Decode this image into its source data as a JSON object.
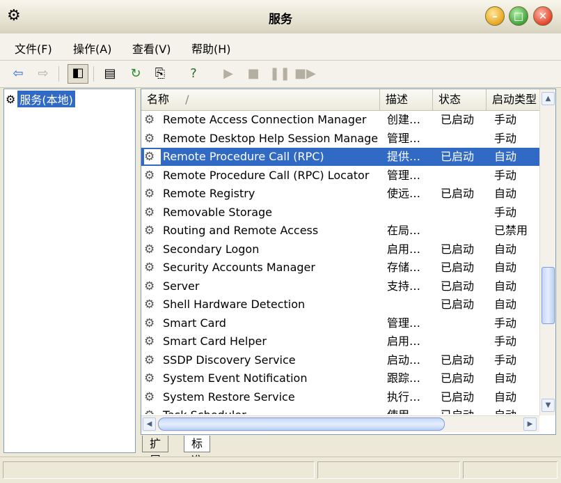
{
  "window": {
    "title": "服务",
    "app_icon": "gears-icon",
    "controls": [
      "minimize",
      "maximize",
      "close"
    ]
  },
  "menu": [
    {
      "label": "文件(F)"
    },
    {
      "label": "操作(A)"
    },
    {
      "label": "查看(V)"
    },
    {
      "label": "帮助(H)"
    }
  ],
  "toolbar": [
    "back",
    "forward",
    "show-hide-console-tree",
    "properties",
    "refresh",
    "export-list",
    "help",
    "start-service",
    "stop-service",
    "pause-service",
    "restart-service"
  ],
  "tree": {
    "root_label": "服务(本地)"
  },
  "list": {
    "columns": [
      "名称",
      "描述",
      "状态",
      "启动类型"
    ],
    "sort_indicator": "/",
    "selected_index": 2,
    "rows": [
      {
        "name": "Remote Access Connection Manager",
        "desc": "创建…",
        "status": "已启动",
        "startup": "手动"
      },
      {
        "name": "Remote Desktop Help Session Manager",
        "desc": "管理…",
        "status": "",
        "startup": "手动"
      },
      {
        "name": "Remote Procedure Call (RPC)",
        "desc": "提供…",
        "status": "已启动",
        "startup": "自动"
      },
      {
        "name": "Remote Procedure Call (RPC) Locator",
        "desc": "管理…",
        "status": "",
        "startup": "手动"
      },
      {
        "name": "Remote Registry",
        "desc": "使远…",
        "status": "已启动",
        "startup": "自动"
      },
      {
        "name": "Removable Storage",
        "desc": "",
        "status": "",
        "startup": "手动"
      },
      {
        "name": "Routing and Remote Access",
        "desc": "在局…",
        "status": "",
        "startup": "已禁用"
      },
      {
        "name": "Secondary Logon",
        "desc": "启用…",
        "status": "已启动",
        "startup": "自动"
      },
      {
        "name": "Security Accounts Manager",
        "desc": "存储…",
        "status": "已启动",
        "startup": "自动"
      },
      {
        "name": "Server",
        "desc": "支持…",
        "status": "已启动",
        "startup": "自动"
      },
      {
        "name": "Shell Hardware Detection",
        "desc": "",
        "status": "已启动",
        "startup": "自动"
      },
      {
        "name": "Smart Card",
        "desc": "管理…",
        "status": "",
        "startup": "手动"
      },
      {
        "name": "Smart Card Helper",
        "desc": "启用…",
        "status": "",
        "startup": "手动"
      },
      {
        "name": "SSDP Discovery Service",
        "desc": "启动…",
        "status": "已启动",
        "startup": "手动"
      },
      {
        "name": "System Event Notification",
        "desc": "跟踪…",
        "status": "已启动",
        "startup": "自动"
      },
      {
        "name": "System Restore Service",
        "desc": "执行…",
        "status": "已启动",
        "startup": "自动"
      },
      {
        "name": "Task Scheduler",
        "desc": "使用…",
        "status": "已启动",
        "startup": "自动"
      }
    ]
  },
  "tabs": [
    {
      "label": "扩展",
      "active": false
    },
    {
      "label": "标准",
      "active": true
    }
  ],
  "colors": {
    "selection": "#316ac5",
    "window_bg": "#ece9d8",
    "pane_border": "#7f9db9"
  }
}
